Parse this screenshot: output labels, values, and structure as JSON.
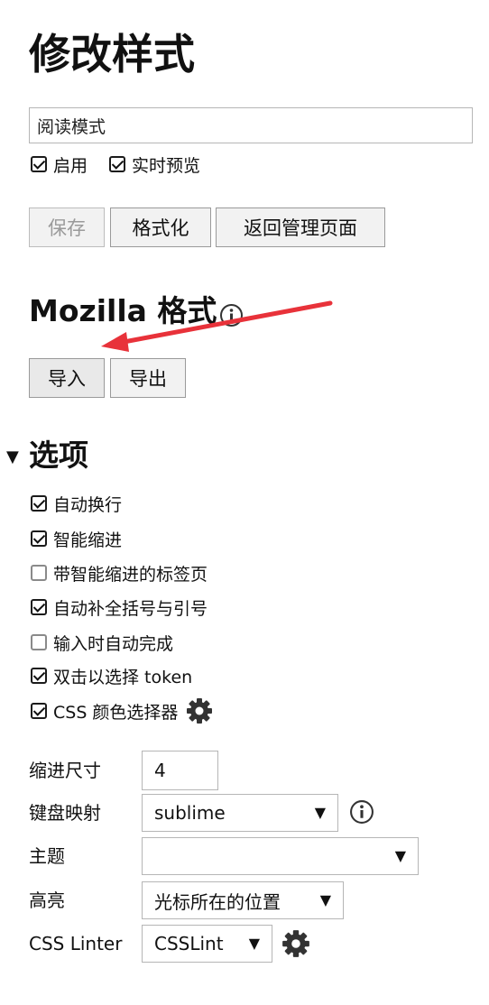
{
  "page": {
    "title": "修改样式"
  },
  "style_name": {
    "value": "阅读模式"
  },
  "toggles": {
    "enabled": "启用",
    "live_preview": "实时预览"
  },
  "actions": {
    "save": "保存",
    "beautify": "格式化",
    "back": "返回管理页面"
  },
  "mozilla": {
    "title": "Mozilla 格式",
    "import": "导入",
    "export": "导出"
  },
  "options": {
    "title": "选项",
    "items": [
      {
        "label": "自动换行",
        "checked": true
      },
      {
        "label": "智能缩进",
        "checked": true
      },
      {
        "label": "带智能缩进的标签页",
        "checked": false
      },
      {
        "label": "自动补全括号与引号",
        "checked": true
      },
      {
        "label": "输入时自动完成",
        "checked": false
      },
      {
        "label": "双击以选择 token",
        "checked": true
      },
      {
        "label": "CSS 颜色选择器",
        "checked": true
      }
    ]
  },
  "settings": {
    "indent_label": "缩进尺寸",
    "indent_value": "4",
    "keymap_label": "键盘映射",
    "keymap_value": "sublime",
    "theme_label": "主题",
    "theme_value": "",
    "highlight_label": "高亮",
    "highlight_value": "光标所在的位置",
    "linter_label": "CSS Linter",
    "linter_value": "CSSLint"
  },
  "colors": {
    "annotation_arrow": "#e8323a",
    "button_bg": "#f2f2f2"
  }
}
